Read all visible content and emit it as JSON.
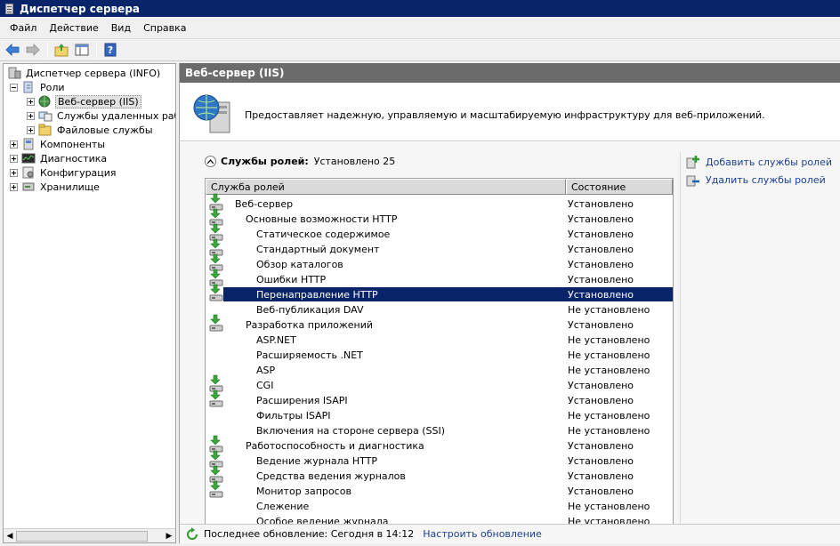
{
  "window": {
    "title": "Диспетчер сервера"
  },
  "menu": [
    "Файл",
    "Действие",
    "Вид",
    "Справка"
  ],
  "tree": {
    "root": "Диспетчер сервера (INFO)",
    "roles": "Роли",
    "web_server": "Веб-сервер (IIS)",
    "remote_services": "Службы удаленных рабоч",
    "file_services": "Файловые службы",
    "components": "Компоненты",
    "diagnostics": "Диагностика",
    "configuration": "Конфигурация",
    "storage": "Хранилище"
  },
  "panel": {
    "header": "Веб-сервер (IIS)",
    "description": "Предоставляет надежную, управляемую и масштабируемую инфраструктуру для веб-приложений."
  },
  "section": {
    "title": "Службы ролей:",
    "installed_text": "Установлено 25"
  },
  "table": {
    "columns": [
      "Служба ролей",
      "Состояние"
    ],
    "rows": [
      {
        "name": "Веб-сервер",
        "status": "Установлено",
        "level": 0,
        "installed": true
      },
      {
        "name": "Основные возможности HTTP",
        "status": "Установлено",
        "level": 1,
        "installed": true
      },
      {
        "name": "Статическое содержимое",
        "status": "Установлено",
        "level": 2,
        "installed": true
      },
      {
        "name": "Стандартный документ",
        "status": "Установлено",
        "level": 2,
        "installed": true
      },
      {
        "name": "Обзор каталогов",
        "status": "Установлено",
        "level": 2,
        "installed": true
      },
      {
        "name": "Ошибки HTTP",
        "status": "Установлено",
        "level": 2,
        "installed": true
      },
      {
        "name": "Перенаправление HTTP",
        "status": "Установлено",
        "level": 2,
        "installed": true,
        "selected": true
      },
      {
        "name": "Веб-публикация DAV",
        "status": "Не установлено",
        "level": 2,
        "installed": false
      },
      {
        "name": "Разработка приложений",
        "status": "Установлено",
        "level": 1,
        "installed": true
      },
      {
        "name": "ASP.NET",
        "status": "Не установлено",
        "level": 2,
        "installed": false
      },
      {
        "name": "Расширяемость .NET",
        "status": "Не установлено",
        "level": 2,
        "installed": false
      },
      {
        "name": "ASP",
        "status": "Не установлено",
        "level": 2,
        "installed": false
      },
      {
        "name": "CGI",
        "status": "Установлено",
        "level": 2,
        "installed": true
      },
      {
        "name": "Расширения ISAPI",
        "status": "Установлено",
        "level": 2,
        "installed": true
      },
      {
        "name": "Фильтры ISAPI",
        "status": "Не установлено",
        "level": 2,
        "installed": false
      },
      {
        "name": "Включения на стороне сервера (SSI)",
        "status": "Не установлено",
        "level": 2,
        "installed": false
      },
      {
        "name": "Работоспособность и диагностика",
        "status": "Установлено",
        "level": 1,
        "installed": true
      },
      {
        "name": "Ведение журнала HTTP",
        "status": "Установлено",
        "level": 2,
        "installed": true
      },
      {
        "name": "Средства ведения журналов",
        "status": "Установлено",
        "level": 2,
        "installed": true
      },
      {
        "name": "Монитор запросов",
        "status": "Установлено",
        "level": 2,
        "installed": true
      },
      {
        "name": "Слежение",
        "status": "Не установлено",
        "level": 2,
        "installed": false
      },
      {
        "name": "Особое ведение журнала",
        "status": "Не установлено",
        "level": 2,
        "installed": false
      }
    ]
  },
  "actions": {
    "add": "Добавить службы ролей",
    "remove": "Удалить службы ролей"
  },
  "status": {
    "last_update": "Последнее обновление: Сегодня в 14:12",
    "configure": "Настроить обновление"
  },
  "colors": {
    "selection": "#0a246a",
    "header_bar": "#6b6b6b",
    "link": "#1b3f8f"
  }
}
